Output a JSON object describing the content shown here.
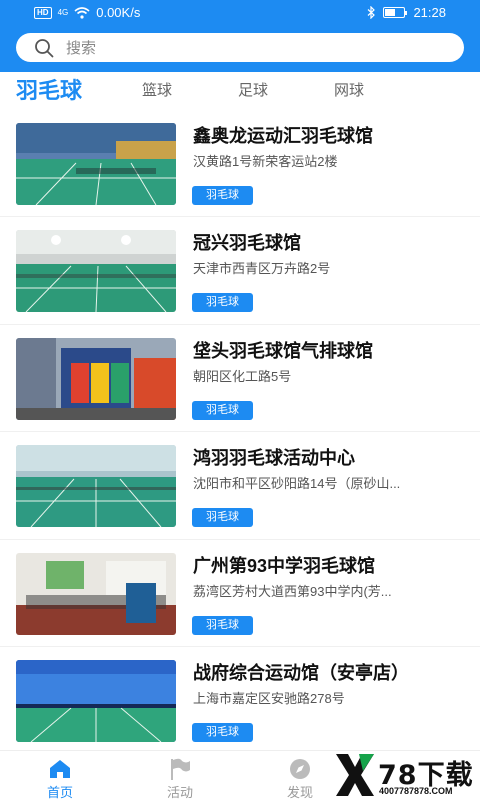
{
  "status_bar": {
    "left_badge": "HD",
    "signal": "4G",
    "speed": "0.00K/s",
    "time": "21:28",
    "battery_level": 0.55
  },
  "search": {
    "placeholder": "搜索"
  },
  "tabs": [
    {
      "label": "羽毛球",
      "active": true
    },
    {
      "label": "篮球",
      "active": false
    },
    {
      "label": "足球",
      "active": false
    },
    {
      "label": "网球",
      "active": false
    }
  ],
  "venues": [
    {
      "title": "鑫奥龙运动汇羽毛球馆",
      "address": "汉黄路1号新荣客运站2楼",
      "tag": "羽毛球"
    },
    {
      "title": "冠兴羽毛球馆",
      "address": "天津市西青区万卉路2号",
      "tag": "羽毛球"
    },
    {
      "title": "垡头羽毛球馆气排球馆",
      "address": "朝阳区化工路5号",
      "tag": "羽毛球"
    },
    {
      "title": "鸿羽羽毛球活动中心",
      "address": "沈阳市和平区砂阳路14号（原砂山...",
      "tag": "羽毛球"
    },
    {
      "title": "广州第93中学羽毛球馆",
      "address": "荔湾区芳村大道西第93中学内(芳...",
      "tag": "羽毛球"
    },
    {
      "title": "战府综合运动馆（安亭店）",
      "address": "上海市嘉定区安驰路278号",
      "tag": "羽毛球"
    }
  ],
  "bottom_nav": [
    {
      "label": "首页",
      "icon": "home-icon",
      "active": true
    },
    {
      "label": "活动",
      "icon": "flag-icon",
      "active": false
    },
    {
      "label": "发现",
      "icon": "compass-icon",
      "active": false
    }
  ],
  "watermark": {
    "big": "78下载",
    "small": "4007787878.COM"
  },
  "colors": {
    "primary": "#1d8bf2",
    "court": "#2f9e7e"
  }
}
